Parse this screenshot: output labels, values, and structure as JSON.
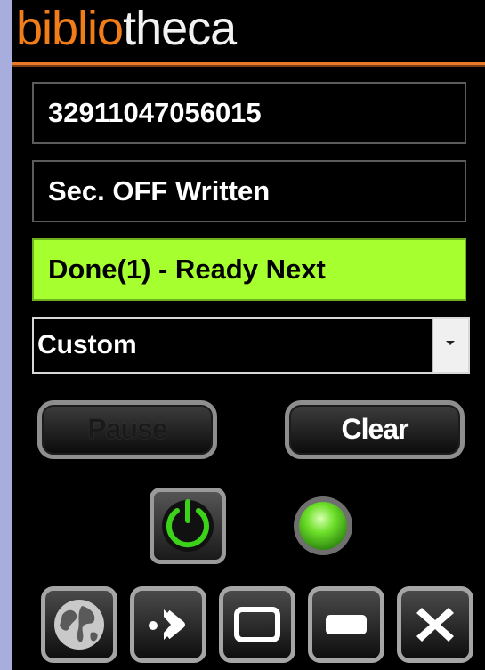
{
  "logo": {
    "part1": "biblio",
    "part2": "theca"
  },
  "fields": {
    "barcode": "32911047056015",
    "security_status": "Sec. OFF Written",
    "process_status": "Done(1) - Ready Next"
  },
  "mode_select": {
    "value": "Custom"
  },
  "buttons": {
    "pause": "Pause",
    "clear": "Clear"
  },
  "icons": {
    "power": "power-icon",
    "status_led": "status-led-icon",
    "bottom": [
      "globe-icon",
      "arrow-right-icon",
      "restore-window-icon",
      "minimize-icon",
      "close-icon"
    ]
  },
  "colors": {
    "brand_orange": "#f07c1a",
    "ready_green": "#a6ff2e",
    "led_green": "#4ec21a",
    "power_ring": "#3cd21a"
  }
}
